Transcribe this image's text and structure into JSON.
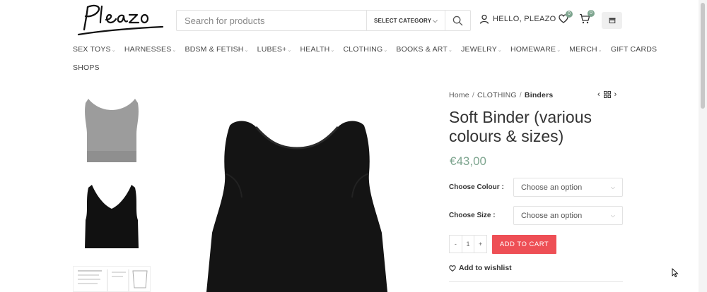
{
  "header": {
    "logo_text": "Pleazo",
    "search_placeholder": "Search for products",
    "category_label": "SELECT CATEGORY",
    "account_label": "HELLO, PLEAZO",
    "wishlist_count": "0",
    "cart_count": "0"
  },
  "nav": {
    "row1": [
      {
        "label": "SEX TOYS"
      },
      {
        "label": "HARNESSES"
      },
      {
        "label": "BDSM & FETISH"
      },
      {
        "label": "LUBES+"
      },
      {
        "label": "HEALTH"
      },
      {
        "label": "CLOTHING"
      },
      {
        "label": "BOOKS & ART"
      },
      {
        "label": "JEWELRY"
      },
      {
        "label": "HOMEWARE"
      },
      {
        "label": "MERCH"
      },
      {
        "label": "GIFT CARDS"
      }
    ],
    "row2": [
      {
        "label": "SHOPS"
      }
    ]
  },
  "breadcrumb": {
    "home": "Home",
    "category": "CLOTHING",
    "current": "Binders",
    "sep": "/"
  },
  "product": {
    "title": "Soft Binder (various colours & sizes)",
    "price": "€43,00",
    "colour_label": "Choose Colour :",
    "colour_value": "Choose an option",
    "size_label": "Choose Size :",
    "size_value": "Choose an option",
    "qty_minus": "-",
    "qty_value": "1",
    "qty_plus": "+",
    "add_to_cart": "ADD TO CART",
    "wishlist": "Add to wishlist"
  },
  "colors": {
    "accent_green": "#7ea58f",
    "cart_red": "#ee4f55"
  }
}
